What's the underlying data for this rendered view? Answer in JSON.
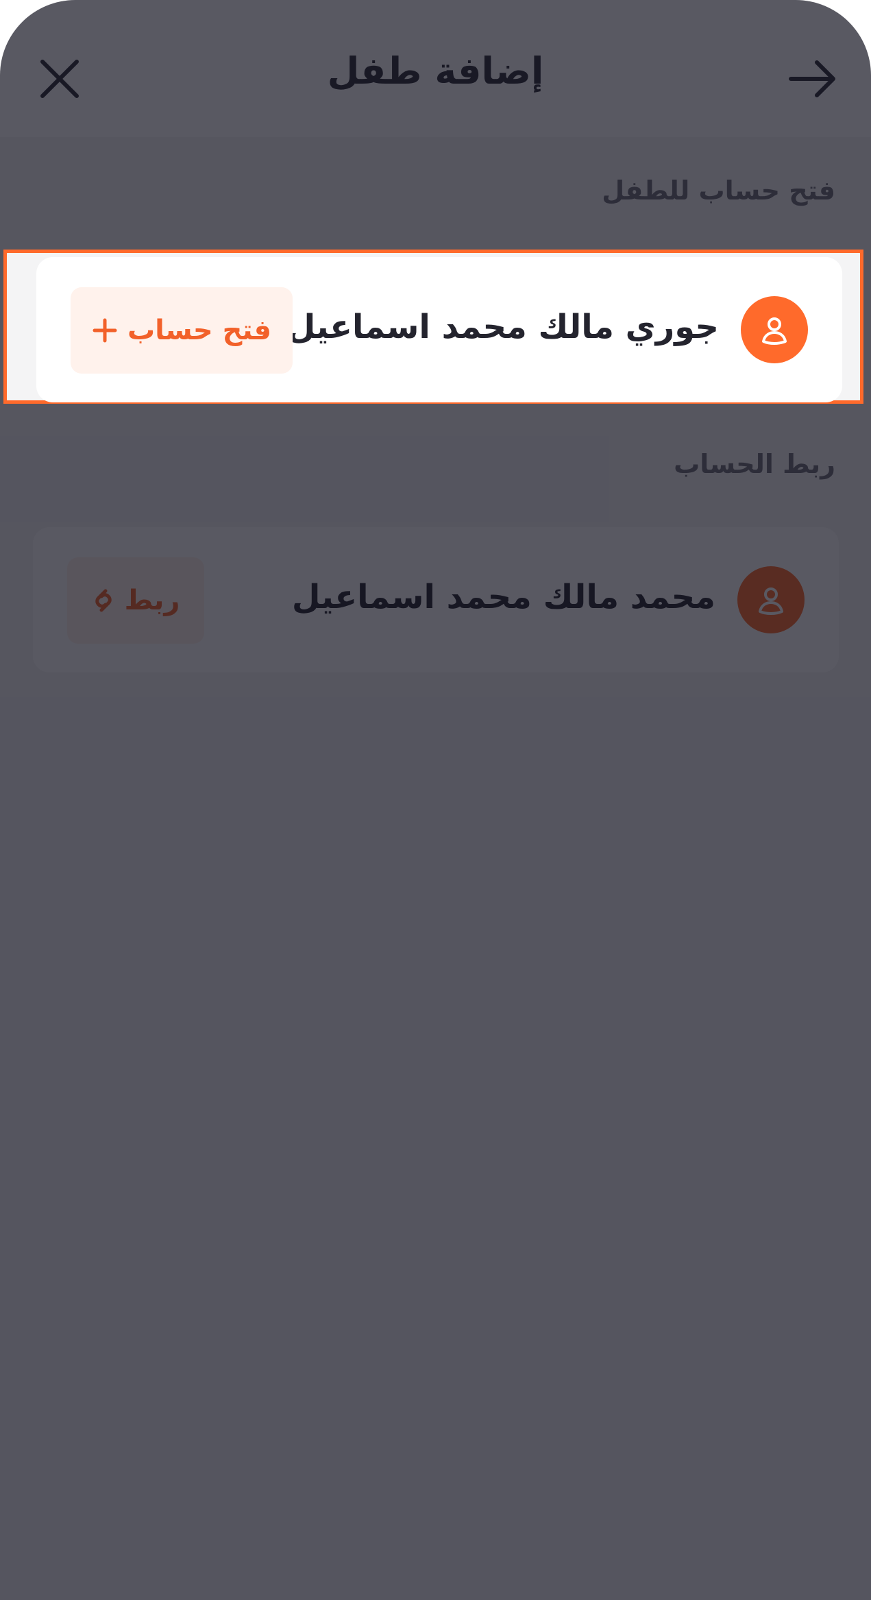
{
  "header": {
    "title": "إضافة طفل",
    "close_icon": "close-icon",
    "back_icon": "arrow-right-icon"
  },
  "sections": {
    "open_account_label": "فتح حساب للطفل",
    "link_account_label": "ربط الحساب"
  },
  "open_card": {
    "name": "جوري مالك محمد اسماعيل",
    "button_label": "فتح حساب",
    "button_icon": "plus-icon",
    "avatar_icon": "user-icon"
  },
  "link_card": {
    "name": "محمد مالك محمد اسماعيل",
    "button_label": "ربط",
    "button_icon": "link-icon",
    "avatar_icon": "user-icon"
  },
  "colors": {
    "accent": "#ff6a2b",
    "button_bg": "#fff2ec",
    "overlay": "#121220"
  }
}
